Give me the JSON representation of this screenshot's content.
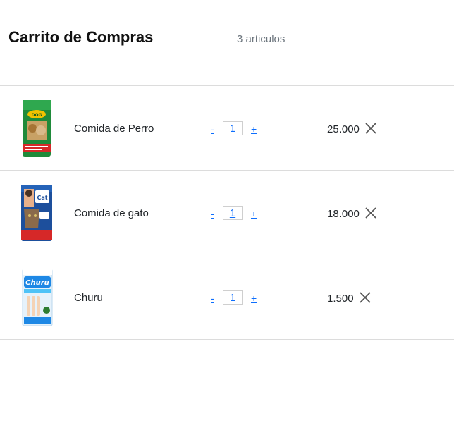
{
  "header": {
    "title": "Carrito de Compras",
    "item_count": "3 articulos"
  },
  "items": [
    {
      "name": "Comida de Perro",
      "quantity": "1",
      "price": "25.000",
      "minus_label": "-",
      "plus_label": "+",
      "image_icon": "dog-food-bag-image",
      "brand_text": "Dog Chow"
    },
    {
      "name": "Comida de gato",
      "quantity": "1",
      "price": "18.000",
      "minus_label": "-",
      "plus_label": "+",
      "image_icon": "cat-food-bag-image",
      "brand_text": "Cat Chow"
    },
    {
      "name": "Churu",
      "quantity": "1",
      "price": "1.500",
      "minus_label": "-",
      "plus_label": "+",
      "image_icon": "churu-package-image",
      "brand_text": "Churu"
    }
  ],
  "remove_icon": "close-icon",
  "colors": {
    "link": "#0d6efd",
    "divider": "#dcdcdc",
    "muted": "#6c757d"
  }
}
